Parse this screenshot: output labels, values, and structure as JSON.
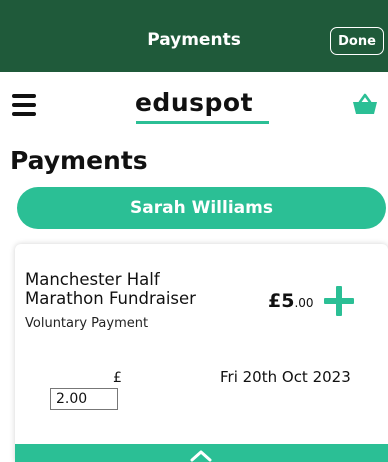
{
  "topbar": {
    "title": "Payments",
    "done_label": "Done"
  },
  "appbar": {
    "brand": "eduspot",
    "menu_icon": "hamburger-menu-icon",
    "basket_icon": "basket-icon"
  },
  "page": {
    "title": "Payments"
  },
  "student": {
    "name": "Sarah Williams"
  },
  "payment": {
    "title_line1": "Manchester Half",
    "title_line2": "Marathon Fundraiser",
    "type": "Voluntary Payment",
    "price_pounds": "£5",
    "price_pence": ".00",
    "currency_symbol": "£",
    "amount_value": "2.00",
    "date": "Fri 20th Oct 2023"
  },
  "colors": {
    "header_green": "#1f5a3a",
    "accent_teal": "#2bbf95"
  }
}
